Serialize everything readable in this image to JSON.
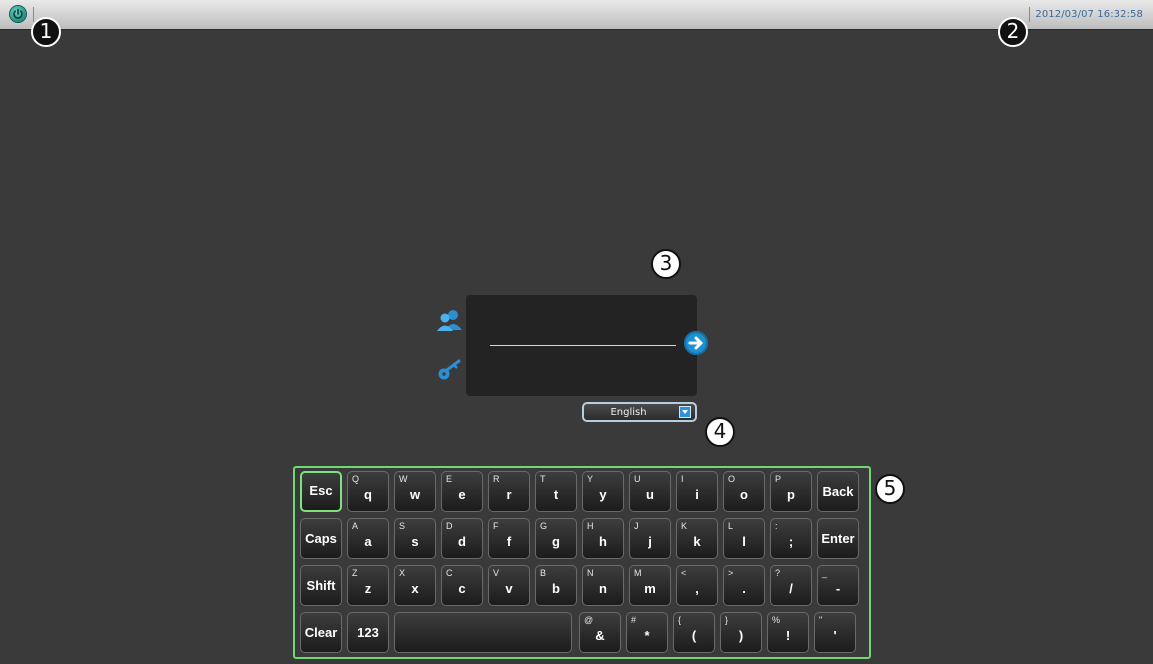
{
  "topbar": {
    "datetime": "2012/03/07 16:32:58"
  },
  "callouts": [
    "1",
    "2",
    "3",
    "4",
    "5"
  ],
  "language": {
    "selected": "English"
  },
  "keyboard": {
    "row1": [
      {
        "main": "Esc",
        "sub": ""
      },
      {
        "main": "q",
        "sub": "Q"
      },
      {
        "main": "w",
        "sub": "W"
      },
      {
        "main": "e",
        "sub": "E"
      },
      {
        "main": "r",
        "sub": "R"
      },
      {
        "main": "t",
        "sub": "T"
      },
      {
        "main": "y",
        "sub": "Y"
      },
      {
        "main": "u",
        "sub": "U"
      },
      {
        "main": "i",
        "sub": "I"
      },
      {
        "main": "o",
        "sub": "O"
      },
      {
        "main": "p",
        "sub": "P"
      },
      {
        "main": "Back",
        "sub": ""
      }
    ],
    "row2": [
      {
        "main": "Caps",
        "sub": ""
      },
      {
        "main": "a",
        "sub": "A"
      },
      {
        "main": "s",
        "sub": "S"
      },
      {
        "main": "d",
        "sub": "D"
      },
      {
        "main": "f",
        "sub": "F"
      },
      {
        "main": "g",
        "sub": "G"
      },
      {
        "main": "h",
        "sub": "H"
      },
      {
        "main": "j",
        "sub": "J"
      },
      {
        "main": "k",
        "sub": "K"
      },
      {
        "main": "l",
        "sub": "L"
      },
      {
        "main": ";",
        "sub": ":"
      },
      {
        "main": "Enter",
        "sub": ""
      }
    ],
    "row3": [
      {
        "main": "Shift",
        "sub": ""
      },
      {
        "main": "z",
        "sub": "Z"
      },
      {
        "main": "x",
        "sub": "X"
      },
      {
        "main": "c",
        "sub": "C"
      },
      {
        "main": "v",
        "sub": "V"
      },
      {
        "main": "b",
        "sub": "B"
      },
      {
        "main": "n",
        "sub": "N"
      },
      {
        "main": "m",
        "sub": "M"
      },
      {
        "main": ",",
        "sub": "<"
      },
      {
        "main": ".",
        "sub": ">"
      },
      {
        "main": "/",
        "sub": "?"
      },
      {
        "main": "-",
        "sub": "_"
      }
    ],
    "row4": [
      {
        "main": "Clear",
        "sub": ""
      },
      {
        "main": "123",
        "sub": ""
      },
      {
        "main": "",
        "sub": ""
      },
      {
        "main": "&",
        "sub": "@"
      },
      {
        "main": "*",
        "sub": "#"
      },
      {
        "main": "(",
        "sub": "{"
      },
      {
        "main": ")",
        "sub": "}"
      },
      {
        "main": "!",
        "sub": "%"
      },
      {
        "main": "'",
        "sub": "\""
      }
    ]
  }
}
